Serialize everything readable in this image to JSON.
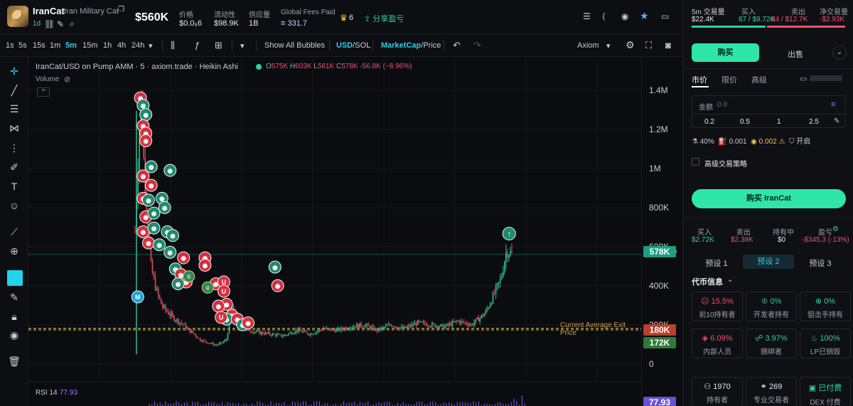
{
  "token": {
    "symbol": "IranCat",
    "full_name": "Iran Military Cat",
    "age": "1d",
    "market_cap": "$560K"
  },
  "stats": [
    {
      "label": "价格",
      "value": "$0.0₅6"
    },
    {
      "label": "流动性",
      "value": "$98.9K"
    },
    {
      "label": "供应量",
      "value": "1B"
    },
    {
      "label": "Global Fees Paid",
      "value": "≡ 331.7"
    }
  ],
  "badges": {
    "holders_crown": "6",
    "share_label": "分享盈亏"
  },
  "toolbar": {
    "timeframes": [
      "1s",
      "5s",
      "15s",
      "1m",
      "5m",
      "15m",
      "1h",
      "4h",
      "24h"
    ],
    "active_timeframe": "5m",
    "show_bubbles": "Show All Bubbles",
    "usd": "USD",
    "sol": "SOL",
    "marketcap": "MarketCap",
    "price": "Price",
    "source": "Axiom"
  },
  "chart_header": {
    "title": "IranCat/USD on Pump AMM · 5 · axiom.trade · Heikin Ashi",
    "volume_label": "Volume",
    "ohlc": {
      "o": "575K",
      "h": "603K",
      "l": "561K",
      "c": "578K",
      "chg": "-56.8K (−8.96%)"
    }
  },
  "chart_data": {
    "type": "line",
    "style": "Heikin Ashi candles (market cap)",
    "y_ticks": [
      "1.4M",
      "1.2M",
      "1M",
      "800K",
      "600K",
      "400K",
      "200K",
      "0"
    ],
    "ylim": [
      0,
      1480000
    ],
    "current_price_label": "578K",
    "avg_exit_label": "180K",
    "avg_exit_text": "Current Average Exit Price",
    "avg_entry_label": "172K",
    "grid": true,
    "trend": [
      [
        0,
        700000
      ],
      [
        2,
        1400000
      ],
      [
        4,
        900000
      ],
      [
        6,
        500000
      ],
      [
        8,
        380000
      ],
      [
        10,
        300000
      ],
      [
        12,
        270000
      ],
      [
        14,
        240000
      ],
      [
        16,
        220000
      ],
      [
        18,
        200000
      ],
      [
        20,
        170000
      ],
      [
        22,
        150000
      ],
      [
        24,
        120000
      ],
      [
        26,
        110000
      ],
      [
        28,
        100000
      ],
      [
        30,
        90000
      ],
      [
        32,
        100000
      ],
      [
        34,
        120000
      ],
      [
        36,
        300000
      ],
      [
        38,
        200000
      ],
      [
        40,
        180000
      ],
      [
        45,
        160000
      ],
      [
        50,
        150000
      ],
      [
        55,
        140000
      ],
      [
        60,
        170000
      ],
      [
        65,
        150000
      ],
      [
        70,
        180000
      ],
      [
        75,
        170000
      ],
      [
        80,
        190000
      ],
      [
        85,
        200000
      ],
      [
        90,
        170000
      ],
      [
        95,
        200000
      ],
      [
        100,
        180000
      ],
      [
        105,
        210000
      ],
      [
        110,
        200000
      ],
      [
        115,
        190000
      ],
      [
        120,
        220000
      ],
      [
        125,
        200000
      ],
      [
        130,
        260000
      ],
      [
        133,
        350000
      ],
      [
        136,
        450000
      ],
      [
        138,
        600000
      ],
      [
        140,
        578000
      ]
    ]
  },
  "rsi": {
    "label": "RSI 14",
    "value": "77.93"
  },
  "panel": {
    "vol_label": "5m 交易量",
    "vol_value": "$22.4K",
    "buy_label": "买入",
    "buy_value": "87 / $9.72K",
    "sell_label": "卖出",
    "sell_value": "84 / $12.7K",
    "net_label": "净交易量",
    "net_value": "-$2.93K",
    "buy_tab": "购买",
    "sell_tab": "出售",
    "order_tabs": [
      "市价",
      "限价",
      "高级"
    ],
    "amount_label": "金额",
    "amount_value": "0.0",
    "quick_amounts": [
      "0.2",
      "0.5",
      "1",
      "2.5"
    ],
    "slippage": "40%",
    "priority": "0.001",
    "bribe": "0.002",
    "mev": "开启",
    "advanced_strategy": "高级交易策略",
    "buy_button": "购买 IranCat",
    "pos": [
      {
        "label": "买入",
        "value": "$2.72K"
      },
      {
        "label": "卖出",
        "value": "$2.38K"
      },
      {
        "label": "持有中",
        "value": "$0"
      },
      {
        "label": "盈亏",
        "value": "-$345.3 (-13%)"
      }
    ],
    "presets": [
      "预设 1",
      "预设 2",
      "预设 3"
    ],
    "token_info_title": "代币信息",
    "tiles": [
      {
        "value": "15.5%",
        "label": "前10持有者"
      },
      {
        "value": "0%",
        "label": "开发者持有"
      },
      {
        "value": "0%",
        "label": "狙击手持有"
      },
      {
        "value": "6.09%",
        "label": "内部人员"
      },
      {
        "value": "3.97%",
        "label": "捆绑者"
      },
      {
        "value": "100%",
        "label": "LP已销毁"
      },
      {
        "value": "1970",
        "label": "持有者"
      },
      {
        "value": "269",
        "label": "专业交易者"
      },
      {
        "value": "已付费",
        "label": "DEX 付费"
      }
    ]
  }
}
